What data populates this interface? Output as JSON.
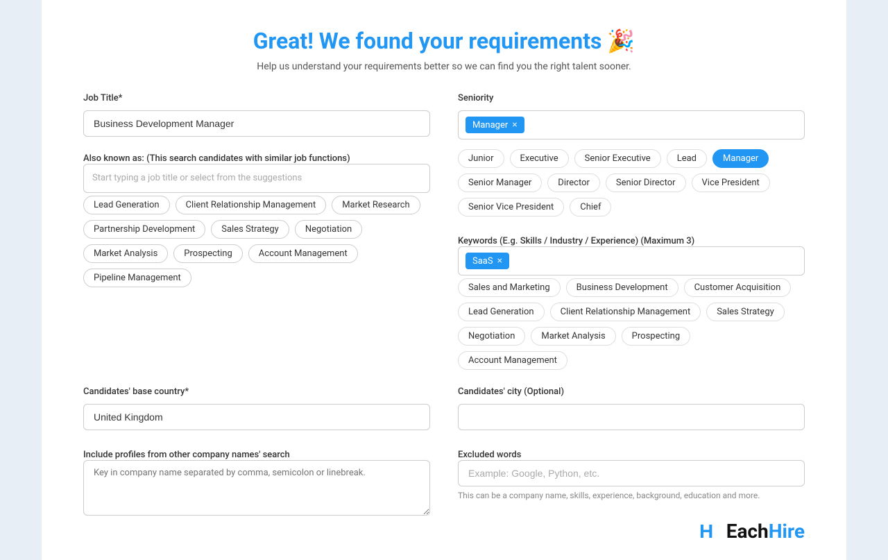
{
  "header": {
    "title": "Great! We found your requirements 🎉",
    "subtitle": "Help us understand your requirements better so we can find you the right talent sooner."
  },
  "job_title": {
    "label": "Job Title*",
    "value": "Business Development Manager",
    "placeholder": "Business Development Manager"
  },
  "also_known_as": {
    "label": "Also known as: (This search candidates with similar job functions)",
    "placeholder": "Start typing a job title or select from the suggestions",
    "tags": [
      "Lead Generation",
      "Client Relationship Management",
      "Market Research",
      "Partnership Development",
      "Sales Strategy",
      "Negotiation",
      "Market Analysis",
      "Prospecting",
      "Account Management",
      "Pipeline Management"
    ]
  },
  "seniority": {
    "label": "Seniority",
    "selected": "Manager",
    "options": [
      "Junior",
      "Executive",
      "Senior Executive",
      "Lead",
      "Manager",
      "Senior Manager",
      "Director",
      "Senior Director",
      "Vice President",
      "Senior Vice President",
      "Chief"
    ]
  },
  "keywords": {
    "label": "Keywords (E.g. Skills / Industry / Experience) (Maximum 3)",
    "selected": "SaaS",
    "suggestions": [
      "Sales and Marketing",
      "Business Development",
      "Customer Acquisition",
      "Lead Generation",
      "Client Relationship Management",
      "Sales Strategy",
      "Negotiation",
      "Market Analysis",
      "Prospecting",
      "Account Management"
    ]
  },
  "base_country": {
    "label": "Candidates' base country*",
    "value": "United Kingdom",
    "placeholder": "United Kingdom"
  },
  "city": {
    "label": "Candidates' city (Optional)",
    "value": "",
    "placeholder": ""
  },
  "company_profiles": {
    "label": "Include profiles from other company names' search",
    "placeholder": "Key in company name separated by comma, semicolon or linebreak."
  },
  "excluded_words": {
    "label": "Excluded words",
    "placeholder": "Example: Google, Python, etc.",
    "hint": "This can be a company name, skills, experience, background, education and more."
  },
  "logo": {
    "text": "EachHire",
    "each_part": "Each",
    "hire_part": "Hire"
  }
}
